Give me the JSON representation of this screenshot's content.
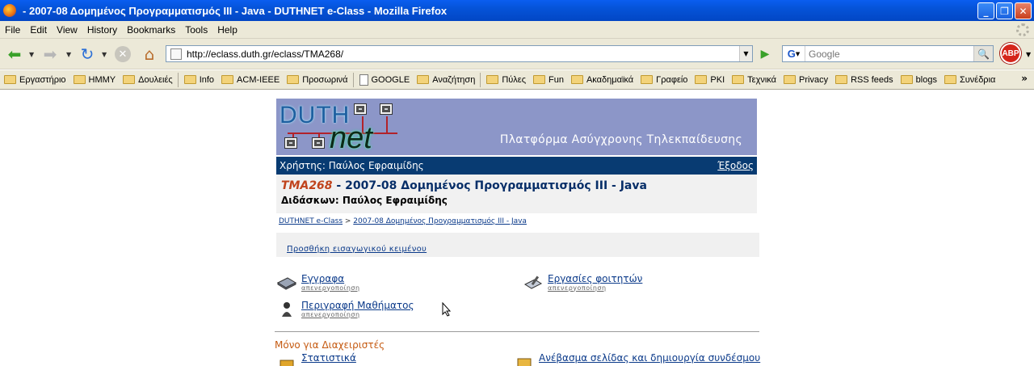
{
  "window": {
    "title": "2007-08 Δομημένος Προγραμματισμός III - Java - DUTHNET e-Class - Mozilla Firefox",
    "title_prefix": "-"
  },
  "menu": [
    "File",
    "Edit",
    "View",
    "History",
    "Bookmarks",
    "Tools",
    "Help"
  ],
  "toolbar": {
    "url": "http://eclass.duth.gr/eclass/TMA268/",
    "search_placeholder": "Google",
    "search_engine_letter": "G",
    "adblock_label": "ABP"
  },
  "bookmarks": [
    {
      "label": "Εργαστήριο",
      "type": "folder"
    },
    {
      "label": "ΗΜΜΥ",
      "type": "folder"
    },
    {
      "label": "Δουλειές",
      "type": "folder"
    },
    {
      "label": "Info",
      "type": "folder"
    },
    {
      "label": "ACM-IEEE",
      "type": "folder"
    },
    {
      "label": "Προσωρινά",
      "type": "folder"
    },
    {
      "label": "GOOGLE",
      "type": "page"
    },
    {
      "label": "Αναζήτηση",
      "type": "folder"
    },
    {
      "label": "Πύλες",
      "type": "folder"
    },
    {
      "label": "Fun",
      "type": "folder"
    },
    {
      "label": "Ακαδημαϊκά",
      "type": "folder"
    },
    {
      "label": "Γραφείο",
      "type": "folder"
    },
    {
      "label": "PKI",
      "type": "folder"
    },
    {
      "label": "Τεχνικά",
      "type": "folder"
    },
    {
      "label": "Privacy",
      "type": "folder"
    },
    {
      "label": "RSS feeds",
      "type": "folder"
    },
    {
      "label": "blogs",
      "type": "folder"
    },
    {
      "label": "Συνέδρια",
      "type": "folder"
    }
  ],
  "page": {
    "logo_top": "DUTH",
    "logo_bottom": "net",
    "banner_subtitle": "Πλατφόρμα Ασύγχρονης Τηλεκπαίδευσης",
    "user_label": "Χρήστης: Παύλος Εφραιμίδης",
    "logout": "Έξοδος",
    "course_code": "TMA268",
    "course_title": " - 2007-08 Δομημένος Προγραμματισμός III - Java",
    "teacher": "Διδάσκων: Παύλος Εφραιμίδης",
    "breadcrumb_home": "DUTHNET e-Class",
    "breadcrumb_sep": " > ",
    "breadcrumb_course": "2007-08 Δομημένος Προγραμματισμός III - Java",
    "add_intro": "Προσθήκη εισαγωγικού κειμένου",
    "tools": [
      {
        "name": "Εγγραφα",
        "status": "απενεργοποίηση",
        "icon": "documents-icon"
      },
      {
        "name": "Εργασίες φοιτητών",
        "status": "απενεργοποίηση",
        "icon": "assignments-icon"
      },
      {
        "name": "Περιγραφή Μαθήματος",
        "status": "απενεργοποίηση",
        "icon": "course-description-icon"
      }
    ],
    "admin_label": "Μόνο για Διαχειριστές",
    "admin_tools": [
      {
        "name": "Στατιστικά",
        "icon": "statistics-icon"
      },
      {
        "name": "Ανέβασμα σελίδας και δημιουργία συνδέσμου",
        "icon": "upload-page-icon"
      }
    ]
  }
}
